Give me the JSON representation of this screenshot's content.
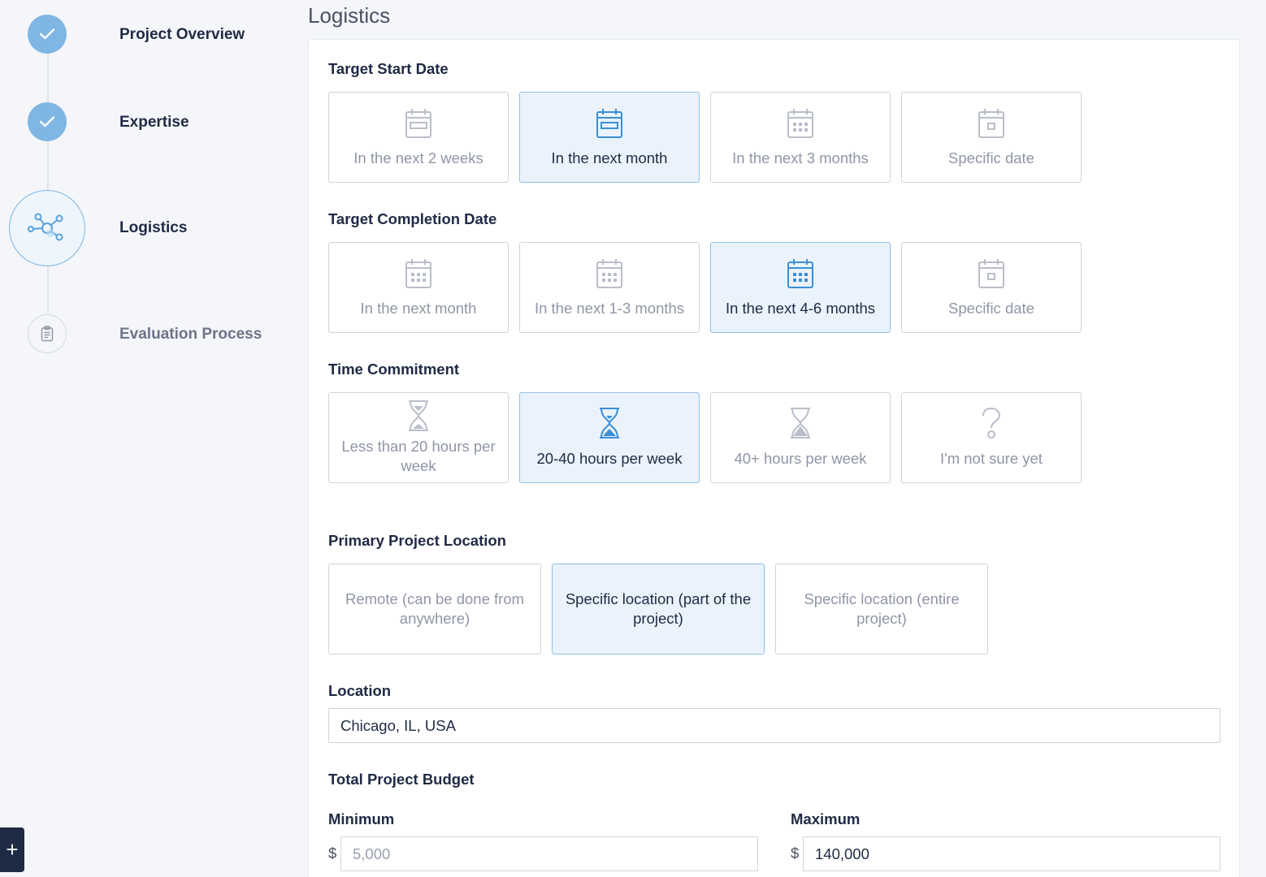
{
  "stepper": {
    "steps": [
      {
        "label": "Project Overview",
        "state": "done"
      },
      {
        "label": "Expertise",
        "state": "done"
      },
      {
        "label": "Logistics",
        "state": "current"
      },
      {
        "label": "Evaluation Process",
        "state": "upcoming"
      }
    ]
  },
  "page": {
    "title": "Logistics"
  },
  "colors": {
    "accent": "#7fb6e3",
    "selected_bg": "#eaf3fb",
    "selected_border": "#8fc0e8",
    "text_dark": "#1f2a44",
    "text_muted": "#8f96a6"
  },
  "start_date": {
    "label": "Target Start Date",
    "options": [
      {
        "label": "In the next 2 weeks",
        "icon": "calendar-week-icon",
        "selected": false
      },
      {
        "label": "In the next month",
        "icon": "calendar-month-icon",
        "selected": true
      },
      {
        "label": "In the next 3 months",
        "icon": "calendar-grid-icon",
        "selected": false
      },
      {
        "label": "Specific date",
        "icon": "calendar-day-icon",
        "selected": false
      }
    ]
  },
  "completion_date": {
    "label": "Target Completion Date",
    "options": [
      {
        "label": "In the next month",
        "icon": "calendar-grid-icon",
        "selected": false
      },
      {
        "label": "In the next 1-3 months",
        "icon": "calendar-grid-icon",
        "selected": false
      },
      {
        "label": "In the next 4-6 months",
        "icon": "calendar-grid-icon",
        "selected": true
      },
      {
        "label": "Specific date",
        "icon": "calendar-day-icon",
        "selected": false
      }
    ]
  },
  "time_commitment": {
    "label": "Time Commitment",
    "options": [
      {
        "label": "Less than 20 hours per week",
        "icon": "hourglass-icon",
        "selected": false
      },
      {
        "label": "20-40 hours per week",
        "icon": "hourglass-icon",
        "selected": true
      },
      {
        "label": "40+ hours per week",
        "icon": "hourglass-icon",
        "selected": false
      },
      {
        "label": "I'm not sure yet",
        "icon": "question-icon",
        "selected": false
      }
    ]
  },
  "location_type": {
    "label": "Primary Project Location",
    "options": [
      {
        "label": "Remote (can be done from anywhere)",
        "selected": false
      },
      {
        "label": "Specific location (part of the project)",
        "selected": true
      },
      {
        "label": "Specific location (entire project)",
        "selected": false
      }
    ]
  },
  "location": {
    "label": "Location",
    "value": "Chicago, IL, USA"
  },
  "budget": {
    "label": "Total Project Budget",
    "currency": "$",
    "min_label": "Minimum",
    "min_placeholder": "5,000",
    "min_value": "",
    "max_label": "Maximum",
    "max_value": "140,000"
  },
  "floating_button": {
    "label": "+"
  }
}
